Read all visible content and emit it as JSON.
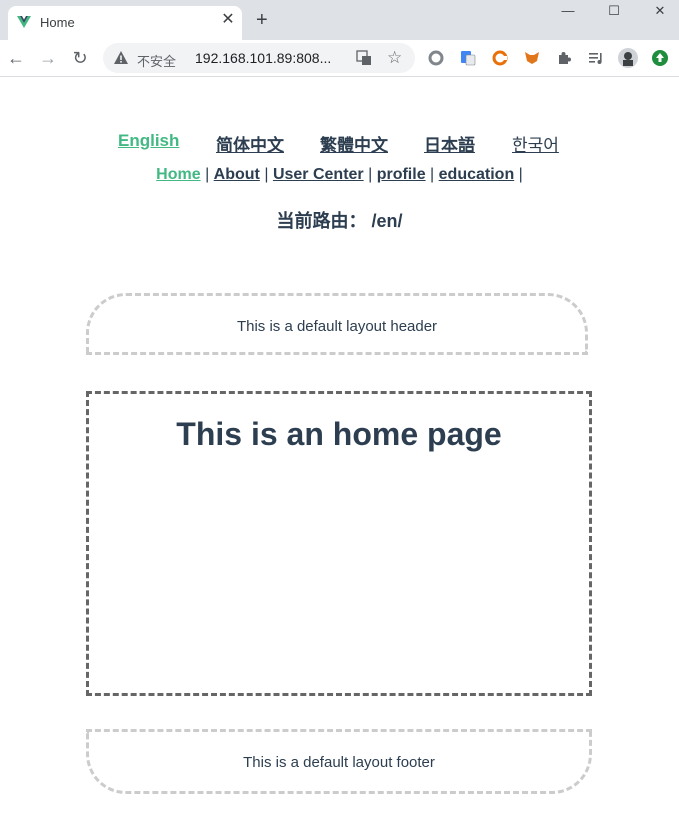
{
  "browser": {
    "tab_title": "Home",
    "tab_close": "✕",
    "new_tab": "+",
    "security_label": "不安全",
    "url": "192.168.101.89:808...",
    "window_controls": {
      "minimize": "—",
      "maximize": "☐",
      "close": "✕"
    },
    "colors": {
      "favicon_green": "#42b983",
      "favicon_dark": "#35495e"
    }
  },
  "languages": [
    {
      "label": "English",
      "active": true
    },
    {
      "label": "简体中文",
      "active": false
    },
    {
      "label": "繁體中文",
      "active": false
    },
    {
      "label": "日本語",
      "active": false
    },
    {
      "label": "한국어",
      "active": false
    }
  ],
  "nav": {
    "home": "Home",
    "about": "About",
    "user_center": "User Center",
    "profile": "profile",
    "education": "education",
    "separator": "|"
  },
  "route": {
    "label": "当前路由：",
    "value": "/en/"
  },
  "layout": {
    "header_text": "This is a default layout header",
    "main_title": "This is an home page",
    "footer_text": "This is a default layout footer"
  },
  "theme": {
    "accent": "#42b983",
    "text": "#2c3e50"
  }
}
